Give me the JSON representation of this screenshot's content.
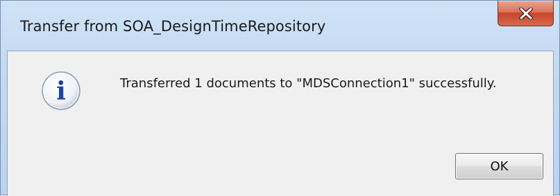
{
  "window": {
    "title": "Transfer from SOA_DesignTimeRepository",
    "close_icon": "close-icon"
  },
  "dialog": {
    "icon": "info-icon",
    "icon_glyph": "i",
    "message": "Transferred 1 documents to \"MDSConnection1\" successfully.",
    "ok_label": "OK"
  },
  "colors": {
    "titlebar": "#c3d9f1",
    "close_button": "#c7452b",
    "client_bg": "#f0f0f0",
    "info_icon": "#1d3fa8"
  }
}
